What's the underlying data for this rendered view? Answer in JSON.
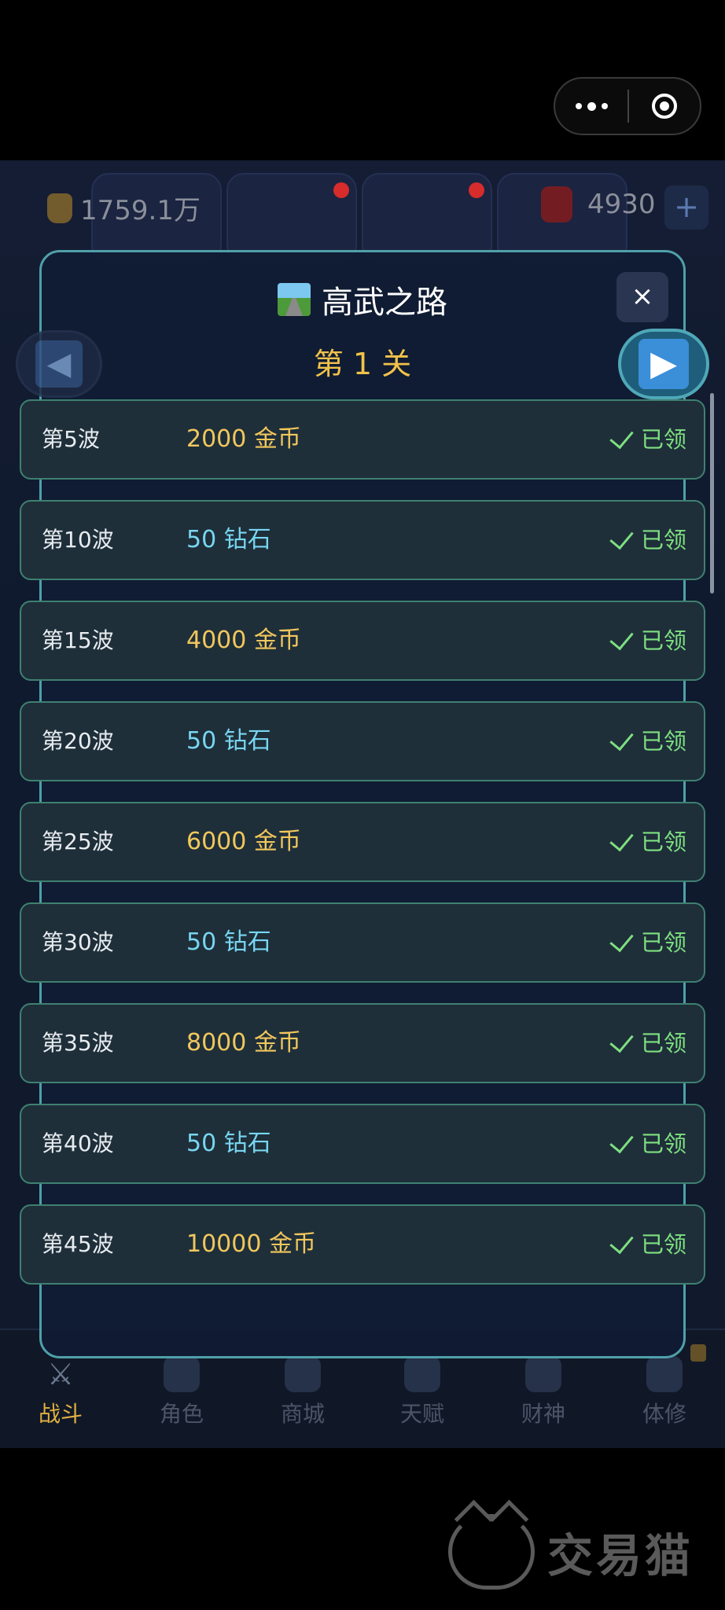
{
  "header": {
    "coins": "1759.1万",
    "diamonds": "4930",
    "plus_label": "+"
  },
  "modal": {
    "title": "高武之路",
    "close_label": "×",
    "level": "第 1 关",
    "prev_label": "◀",
    "next_label": "▶"
  },
  "rewards": [
    {
      "wave": "第5波",
      "prize": "2000 金币",
      "type": "gold",
      "status": "已领"
    },
    {
      "wave": "第10波",
      "prize": "50 钻石",
      "type": "diamond",
      "status": "已领"
    },
    {
      "wave": "第15波",
      "prize": "4000 金币",
      "type": "gold",
      "status": "已领"
    },
    {
      "wave": "第20波",
      "prize": "50 钻石",
      "type": "diamond",
      "status": "已领"
    },
    {
      "wave": "第25波",
      "prize": "6000 金币",
      "type": "gold",
      "status": "已领"
    },
    {
      "wave": "第30波",
      "prize": "50 钻石",
      "type": "diamond",
      "status": "已领"
    },
    {
      "wave": "第35波",
      "prize": "8000 金币",
      "type": "gold",
      "status": "已领"
    },
    {
      "wave": "第40波",
      "prize": "50 钻石",
      "type": "diamond",
      "status": "已领"
    },
    {
      "wave": "第45波",
      "prize": "10000 金币",
      "type": "gold",
      "status": "已领"
    }
  ],
  "bottom_nav": [
    {
      "label": "战斗",
      "active": true
    },
    {
      "label": "角色",
      "active": false
    },
    {
      "label": "商城",
      "active": false
    },
    {
      "label": "天赋",
      "active": false
    },
    {
      "label": "财神",
      "active": false
    },
    {
      "label": "体修",
      "active": false
    }
  ],
  "watermark": "交易猫",
  "colors": {
    "accent_gold": "#f2c75c",
    "diamond": "#78d6f0",
    "claimed": "#7fe080",
    "modal_border": "#4fa0aa"
  }
}
